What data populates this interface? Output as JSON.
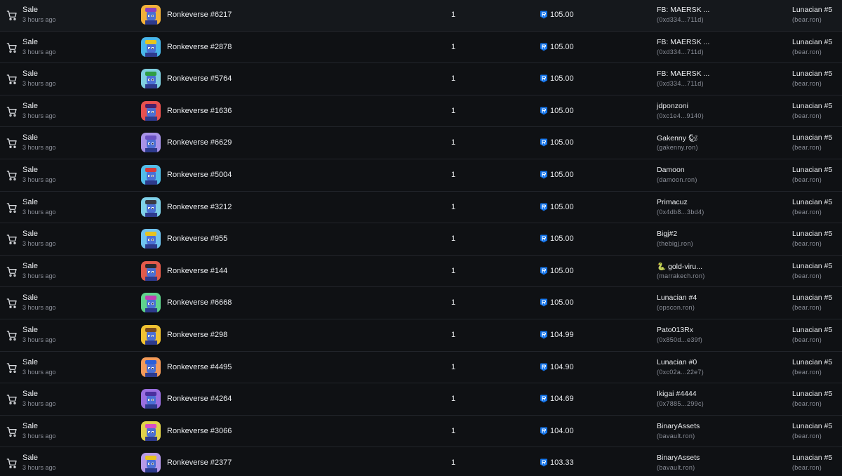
{
  "colors": {
    "background": "#0f1114",
    "row_divider": "#22252b",
    "primary_text": "#eceef1",
    "secondary_text": "#8c909a",
    "ron_token": "#1273ea"
  },
  "icons": {
    "event": "cart-icon",
    "currency": "ron-token-icon"
  },
  "rows": [
    {
      "event": "Sale",
      "time": "3 hours ago",
      "item": "Ronkeverse #6217",
      "qty": "1",
      "price": "105.00",
      "from_name": "FB: MAERSK ...",
      "from_addr": "(0xd334...711d)",
      "to_name": "Lunacian #5",
      "to_addr": "(bear.ron)",
      "thumb_bg": "#f2b13a",
      "thumb_hat": "#8a3fc2"
    },
    {
      "event": "Sale",
      "time": "3 hours ago",
      "item": "Ronkeverse #2878",
      "qty": "1",
      "price": "105.00",
      "from_name": "FB: MAERSK ...",
      "from_addr": "(0xd334...711d)",
      "to_name": "Lunacian #5",
      "to_addr": "(bear.ron)",
      "thumb_bg": "#49b6e8",
      "thumb_hat": "#e7c51d"
    },
    {
      "event": "Sale",
      "time": "3 hours ago",
      "item": "Ronkeverse #5764",
      "qty": "1",
      "price": "105.00",
      "from_name": "FB: MAERSK ...",
      "from_addr": "(0xd334...711d)",
      "to_name": "Lunacian #5",
      "to_addr": "(bear.ron)",
      "thumb_bg": "#7fcfe0",
      "thumb_hat": "#2f9e44"
    },
    {
      "event": "Sale",
      "time": "3 hours ago",
      "item": "Ronkeverse #1636",
      "qty": "1",
      "price": "105.00",
      "from_name": "jdponzoni",
      "from_addr": "(0xc1e4...9140)",
      "to_name": "Lunacian #5",
      "to_addr": "(bear.ron)",
      "thumb_bg": "#e8504f",
      "thumb_hat": "#4a1f6a"
    },
    {
      "event": "Sale",
      "time": "3 hours ago",
      "item": "Ronkeverse #6629",
      "qty": "1",
      "price": "105.00",
      "from_name": "Gakenny 🐿",
      "from_addr": "(gakenny.ron)",
      "to_name": "Lunacian #5",
      "to_addr": "(bear.ron)",
      "thumb_bg": "#a893e8",
      "thumb_hat": "#6b52c4"
    },
    {
      "event": "Sale",
      "time": "3 hours ago",
      "item": "Ronkeverse #5004",
      "qty": "1",
      "price": "105.00",
      "from_name": "Damoon",
      "from_addr": "(damoon.ron)",
      "to_name": "Lunacian #5",
      "to_addr": "(bear.ron)",
      "thumb_bg": "#52bde8",
      "thumb_hat": "#d93a3a"
    },
    {
      "event": "Sale",
      "time": "3 hours ago",
      "item": "Ronkeverse #3212",
      "qty": "1",
      "price": "105.00",
      "from_name": "Primacuz",
      "from_addr": "(0x4db8...3bd4)",
      "to_name": "Lunacian #5",
      "to_addr": "(bear.ron)",
      "thumb_bg": "#7fd0e8",
      "thumb_hat": "#3a3a44"
    },
    {
      "event": "Sale",
      "time": "3 hours ago",
      "item": "Ronkeverse #955",
      "qty": "1",
      "price": "105.00",
      "from_name": "Bigj#2",
      "from_addr": "(thebigj.ron)",
      "to_name": "Lunacian #5",
      "to_addr": "(bear.ron)",
      "thumb_bg": "#6fc3ef",
      "thumb_hat": "#e8c31f"
    },
    {
      "event": "Sale",
      "time": "3 hours ago",
      "item": "Ronkeverse #144",
      "qty": "1",
      "price": "105.00",
      "from_name": "🐍 gold-viru...",
      "from_addr": "(marrakech.ron)",
      "to_name": "Lunacian #5",
      "to_addr": "(bear.ron)",
      "thumb_bg": "#e25a4a",
      "thumb_hat": "#2a2a2e"
    },
    {
      "event": "Sale",
      "time": "3 hours ago",
      "item": "Ronkeverse #6668",
      "qty": "1",
      "price": "105.00",
      "from_name": "Lunacian #4",
      "from_addr": "(opscon.ron)",
      "to_name": "Lunacian #5",
      "to_addr": "(bear.ron)",
      "thumb_bg": "#5fd38c",
      "thumb_hat": "#c23fb4"
    },
    {
      "event": "Sale",
      "time": "3 hours ago",
      "item": "Ronkeverse #298",
      "qty": "1",
      "price": "104.99",
      "from_name": "Pato013Rx",
      "from_addr": "(0x850d...e39f)",
      "to_name": "Lunacian #5",
      "to_addr": "(bear.ron)",
      "thumb_bg": "#f0c232",
      "thumb_hat": "#7a4a1e"
    },
    {
      "event": "Sale",
      "time": "3 hours ago",
      "item": "Ronkeverse #4495",
      "qty": "1",
      "price": "104.90",
      "from_name": "Lunacian #0",
      "from_addr": "(0xc02a...22e7)",
      "to_name": "Lunacian #5",
      "to_addr": "(bear.ron)",
      "thumb_bg": "#f29a5a",
      "thumb_hat": "#2b5fd9"
    },
    {
      "event": "Sale",
      "time": "3 hours ago",
      "item": "Ronkeverse #4264",
      "qty": "1",
      "price": "104.69",
      "from_name": "Ikigai #4444",
      "from_addr": "(0x7885...299c)",
      "to_name": "Lunacian #5",
      "to_addr": "(bear.ron)",
      "thumb_bg": "#9a6fe0",
      "thumb_hat": "#4a2f9e"
    },
    {
      "event": "Sale",
      "time": "3 hours ago",
      "item": "Ronkeverse #3066",
      "qty": "1",
      "price": "104.00",
      "from_name": "BinaryAssets",
      "from_addr": "(bavault.ron)",
      "to_name": "Lunacian #5",
      "to_addr": "(bear.ron)",
      "thumb_bg": "#e0d24a",
      "thumb_hat": "#d94fc4"
    },
    {
      "event": "Sale",
      "time": "3 hours ago",
      "item": "Ronkeverse #2377",
      "qty": "1",
      "price": "103.33",
      "from_name": "BinaryAssets",
      "from_addr": "(bavault.ron)",
      "to_name": "Lunacian #5",
      "to_addr": "(bear.ron)",
      "thumb_bg": "#b79ae8",
      "thumb_hat": "#e8c31f"
    }
  ]
}
